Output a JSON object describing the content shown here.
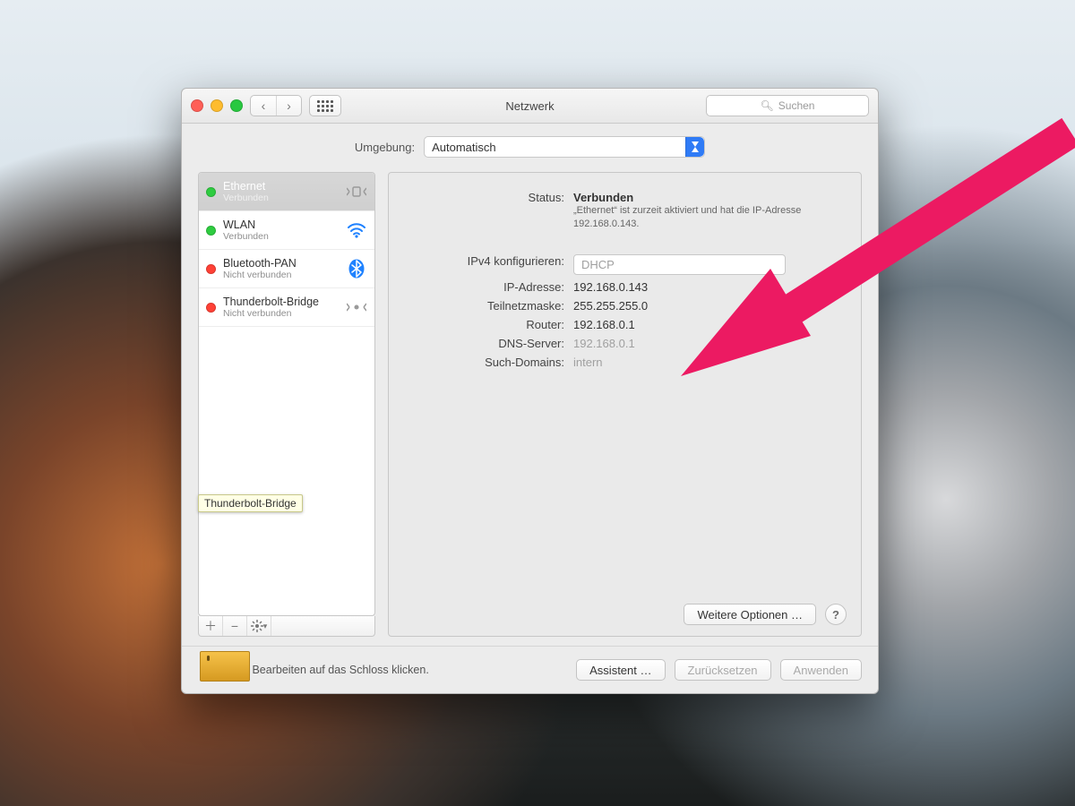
{
  "window": {
    "title": "Netzwerk",
    "search_placeholder": "Suchen"
  },
  "location": {
    "label": "Umgebung:",
    "value": "Automatisch"
  },
  "sidebar": {
    "items": [
      {
        "name": "Ethernet",
        "sub": "Verbunden",
        "status": "green",
        "icon": "ethernet",
        "selected": true
      },
      {
        "name": "WLAN",
        "sub": "Verbunden",
        "status": "green",
        "icon": "wifi"
      },
      {
        "name": "Bluetooth-PAN",
        "sub": "Nicht verbunden",
        "status": "red",
        "icon": "bluetooth"
      },
      {
        "name": "Thunderbolt-Bridge",
        "sub": "Nicht verbunden",
        "status": "red",
        "icon": "thunderbolt"
      }
    ],
    "tooltip": "Thunderbolt-Bridge"
  },
  "detail": {
    "status_label": "Status:",
    "status_value": "Verbunden",
    "status_note": "„Ethernet“ ist zurzeit aktiviert und hat die IP-Adresse 192.168.0.143.",
    "ipv4_label": "IPv4 konfigurieren:",
    "ipv4_value": "DHCP",
    "ip_label": "IP-Adresse:",
    "ip_value": "192.168.0.143",
    "mask_label": "Teilnetzmaske:",
    "mask_value": "255.255.255.0",
    "router_label": "Router:",
    "router_value": "192.168.0.1",
    "dns_label": "DNS-Server:",
    "dns_value": "192.168.0.1",
    "search_label": "Such-Domains:",
    "search_value": "intern",
    "advanced_btn": "Weitere Optionen …"
  },
  "footer": {
    "lock_text": "Zum Bearbeiten auf das Schloss klicken.",
    "assistant": "Assistent …",
    "revert": "Zurücksetzen",
    "apply": "Anwenden"
  }
}
